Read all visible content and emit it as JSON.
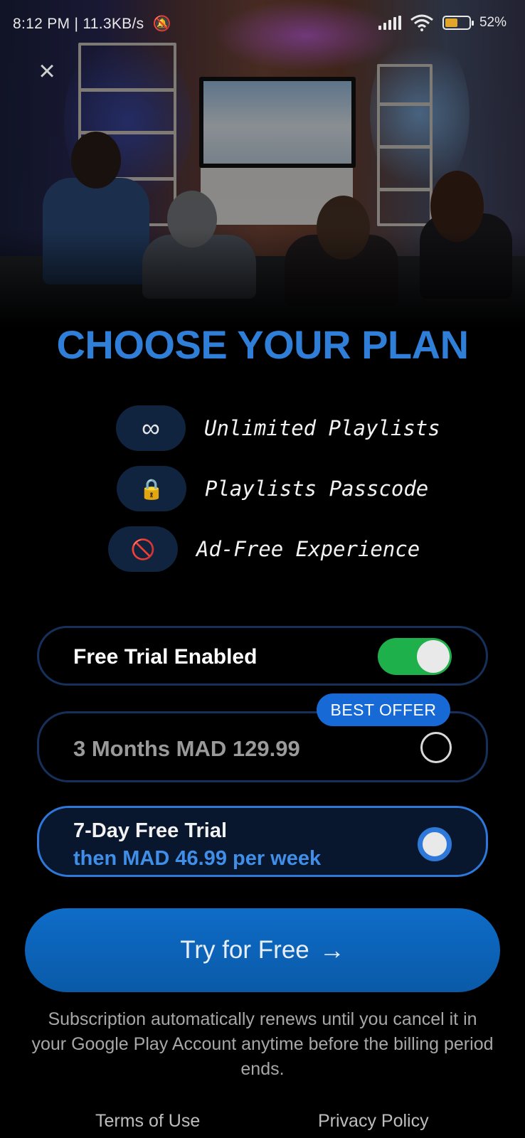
{
  "status_bar": {
    "time_info": "8:12 PM | 11.3KB/s",
    "battery": "52%",
    "battery_level": 0.52,
    "icons": [
      "mute-icon",
      "signal-icon",
      "wifi-icon",
      "battery-icon"
    ]
  },
  "close_icon": "close-icon",
  "title": "CHOOSE YOUR PLAN",
  "features": [
    {
      "icon": "infinity-icon",
      "glyph": "∞",
      "label": "Unlimited Playlists"
    },
    {
      "icon": "lock-icon",
      "glyph": "🔒",
      "label": "Playlists Passcode"
    },
    {
      "icon": "no-ads-icon",
      "glyph": "🚫",
      "label": "Ad-Free Experience"
    }
  ],
  "free_trial": {
    "label": "Free Trial Enabled",
    "enabled": true
  },
  "plans": {
    "quarterly": {
      "label": "3 Months MAD 129.99",
      "badge": "BEST OFFER",
      "selected": false
    },
    "weekly": {
      "line1": "7-Day Free Trial",
      "line2": "then MAD 46.99 per week",
      "selected": true
    }
  },
  "cta": {
    "label": "Try for Free",
    "arrow": "→"
  },
  "disclaimer": "Subscription automatically renews until you cancel it in your Google Play Account anytime before the billing period ends.",
  "links": {
    "terms": "Terms of Use",
    "privacy": "Privacy Policy"
  },
  "colors": {
    "accent": "#2f7fd8",
    "toggle_on": "#1eb04a",
    "cta": "#0e6cc8"
  }
}
